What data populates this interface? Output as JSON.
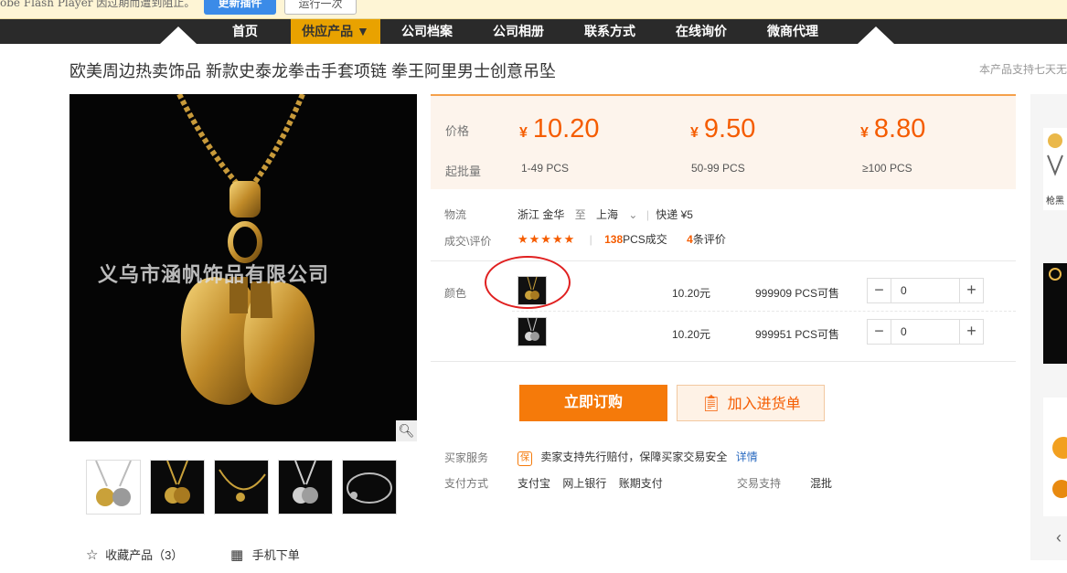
{
  "flash": {
    "text": "obe Flash Player 因过期而遭到阻止。",
    "update_btn": "更新插件",
    "run_btn": "运行一次"
  },
  "nav": {
    "items": [
      "首页",
      "供应产品 ▼",
      "公司档案",
      "公司相册",
      "联系方式",
      "在线询价",
      "微商代理"
    ]
  },
  "product": {
    "title": "欧美周边热卖饰品 新款史泰龙拳击手套项链 拳王阿里男士创意吊坠",
    "tip": "本产品支持七天无"
  },
  "image": {
    "watermark": "义乌市涵帆饰品有限公司"
  },
  "price": {
    "price_label": "价格",
    "min_label": "起批量",
    "tiers": [
      {
        "currency": "¥",
        "price": "10.20",
        "qty": "1-49 PCS"
      },
      {
        "currency": "¥",
        "price": "9.50",
        "qty": "50-99 PCS"
      },
      {
        "currency": "¥",
        "price": "8.80",
        "qty": "≥100 PCS"
      }
    ]
  },
  "logistics": {
    "label": "物流",
    "from": "浙江 金华",
    "to_word": "至",
    "to": "上海",
    "express": "快递 ¥5"
  },
  "deals": {
    "label": "成交\\评价",
    "stars": "★★★★★",
    "sold_num": "138",
    "sold_text": "PCS成交",
    "review_num": "4",
    "review_text": "条评价"
  },
  "color": {
    "label": "颜色",
    "rows": [
      {
        "price": "10.20元",
        "stock": "999909 PCS可售",
        "qty": "0"
      },
      {
        "price": "10.20元",
        "stock": "999951 PCS可售",
        "qty": "0"
      }
    ]
  },
  "buttons": {
    "buy": "立即订购",
    "cart": "加入进货单"
  },
  "service": {
    "label": "买家服务",
    "badge": "保",
    "text": "卖家支持先行赔付，保障买家交易安全",
    "detail": "详情",
    "pay_label": "支付方式",
    "pay_methods": [
      "支付宝",
      "网上银行",
      "账期支付"
    ],
    "trade_label": "交易支持",
    "trade_value": "混批"
  },
  "favorites": {
    "fav": "收藏产品（3）",
    "mobile": "手机下单"
  },
  "sidebar": {
    "caption": "枪黑"
  },
  "icons": [
    "magnifier-icon",
    "star-icon",
    "qrcode-icon",
    "shield-icon",
    "clipboard-icon",
    "chevron-down-icon",
    "minus-icon",
    "plus-icon",
    "chevron-left-icon"
  ]
}
